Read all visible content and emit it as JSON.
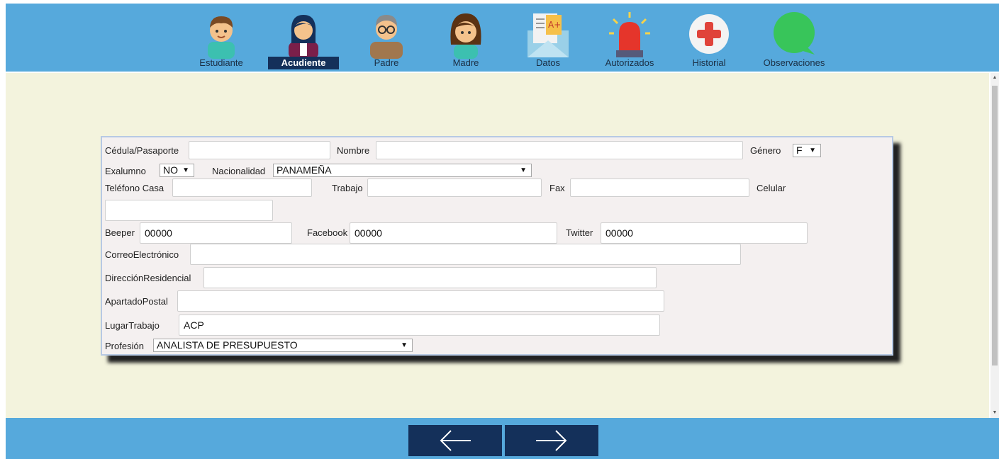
{
  "nav": {
    "tabs": [
      {
        "label": "Estudiante",
        "icon": "student-boy-icon"
      },
      {
        "label": "Acudiente",
        "icon": "guardian-woman-icon"
      },
      {
        "label": "Padre",
        "icon": "father-icon"
      },
      {
        "label": "Madre",
        "icon": "mother-icon"
      },
      {
        "label": "Datos",
        "icon": "envelope-grade-icon"
      },
      {
        "label": "Autorizados",
        "icon": "alarm-siren-icon"
      },
      {
        "label": "Historial",
        "icon": "medical-cross-icon"
      },
      {
        "label": "Observaciones",
        "icon": "speech-bubble-icon"
      }
    ],
    "active": "Acudiente"
  },
  "form": {
    "cedula": {
      "label": "Cédula/Pasaporte",
      "value": ""
    },
    "nombre": {
      "label": "Nombre",
      "value": ""
    },
    "genero": {
      "label": "Género",
      "value": "F"
    },
    "exalumno": {
      "label": "Exalumno",
      "value": "NO"
    },
    "nacionalidad": {
      "label": "Nacionalidad",
      "value": "PANAMEÑA"
    },
    "telefono_casa": {
      "label": "Teléfono Casa",
      "value": ""
    },
    "trabajo": {
      "label": "Trabajo",
      "value": ""
    },
    "fax": {
      "label": "Fax",
      "value": ""
    },
    "celular": {
      "label": "Celular",
      "value": ""
    },
    "beeper": {
      "label": "Beeper",
      "value": "00000"
    },
    "facebook": {
      "label": "Facebook",
      "value": "00000"
    },
    "twitter": {
      "label": "Twitter",
      "value": "00000"
    },
    "correo": {
      "label": "CorreoElectrónico",
      "value": ""
    },
    "direccion": {
      "label": "DirecciónResidencial",
      "value": ""
    },
    "apartado": {
      "label": "ApartadoPostal",
      "value": ""
    },
    "lugar_trabajo": {
      "label": "LugarTrabajo",
      "value": "ACP"
    },
    "profesion": {
      "label": "Profesión",
      "value": "ANALISTA DE PRESUPUESTO"
    }
  },
  "footer": {
    "prev": "←",
    "next": "→"
  },
  "colors": {
    "bar": "#56a9dc",
    "active_tab": "#14305a",
    "content_bg": "#f3f3dd",
    "panel_bg": "#f4f0f0"
  }
}
